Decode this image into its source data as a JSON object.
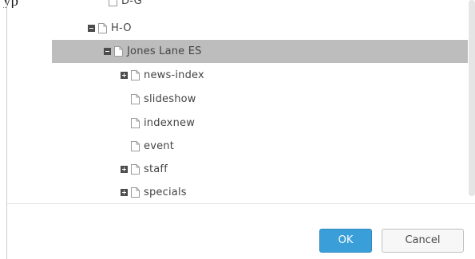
{
  "top_cutoff_text": "yp",
  "tree": [
    {
      "label": "D-G",
      "toggle": "none",
      "depth": 0,
      "selected": false,
      "partial": true
    },
    {
      "label": "H-O",
      "toggle": "minus",
      "depth": 0,
      "selected": false
    },
    {
      "label": "Jones Lane ES",
      "toggle": "minus",
      "depth": 1,
      "selected": true
    },
    {
      "label": "news-index",
      "toggle": "plus",
      "depth": 2,
      "selected": false
    },
    {
      "label": "slideshow",
      "toggle": "none",
      "depth": 2,
      "selected": false
    },
    {
      "label": "indexnew",
      "toggle": "none",
      "depth": 2,
      "selected": false
    },
    {
      "label": "event",
      "toggle": "none",
      "depth": 2,
      "selected": false
    },
    {
      "label": "staff",
      "toggle": "plus",
      "depth": 2,
      "selected": false
    },
    {
      "label": "specials",
      "toggle": "plus",
      "depth": 2,
      "selected": false
    }
  ],
  "buttons": {
    "ok_label": "OK",
    "cancel_label": "Cancel"
  },
  "colors": {
    "selected_row": "#bdbdbd",
    "ok_button": "#3a9fd9",
    "toggle": "#4d4d4d",
    "text": "#444444"
  },
  "icons": {
    "page": "page-icon",
    "expand": "expand-icon",
    "collapse": "collapse-icon"
  }
}
